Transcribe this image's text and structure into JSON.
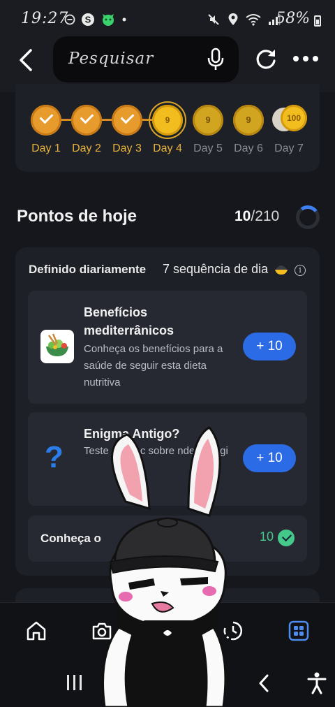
{
  "status_bar": {
    "time": "19:27",
    "battery": "58%"
  },
  "top_bar": {
    "search_placeholder": "Pesquisar"
  },
  "streak": {
    "days": [
      {
        "label": "Day 1",
        "state": "done"
      },
      {
        "label": "Day 2",
        "state": "done"
      },
      {
        "label": "Day 3",
        "state": "done"
      },
      {
        "label": "Day 4",
        "state": "today",
        "coin_value": "9"
      },
      {
        "label": "Day 5",
        "state": "future",
        "coin_value": "9"
      },
      {
        "label": "Day 6",
        "state": "future",
        "coin_value": "9"
      },
      {
        "label": "Day 7",
        "state": "future",
        "coin_value": "100"
      }
    ]
  },
  "points": {
    "title": "Pontos de hoje",
    "earned": "10",
    "total": "/210",
    "progress_fraction": 0.048
  },
  "daily": {
    "label": "Definido diariamente",
    "sequence": "7 sequência de dia",
    "tasks": [
      {
        "title": "Benefícios mediterrânicos",
        "description": "Conheça os benefícios para a saúde de seguir esta dieta nutritiva",
        "points": "+ 10"
      },
      {
        "title": "Enigma Antigo?",
        "description": "Teste     conhec     sobre     nde Es     Egi",
        "points": "+ 10"
      },
      {
        "title": "Conheça o",
        "points": "10",
        "completed": true
      }
    ]
  },
  "colors": {
    "accent": "#2b6be6",
    "coin_gold": "#f2bd1f",
    "streak_done": "#e79b2c",
    "success": "#45c98a",
    "background": "#16171c"
  }
}
